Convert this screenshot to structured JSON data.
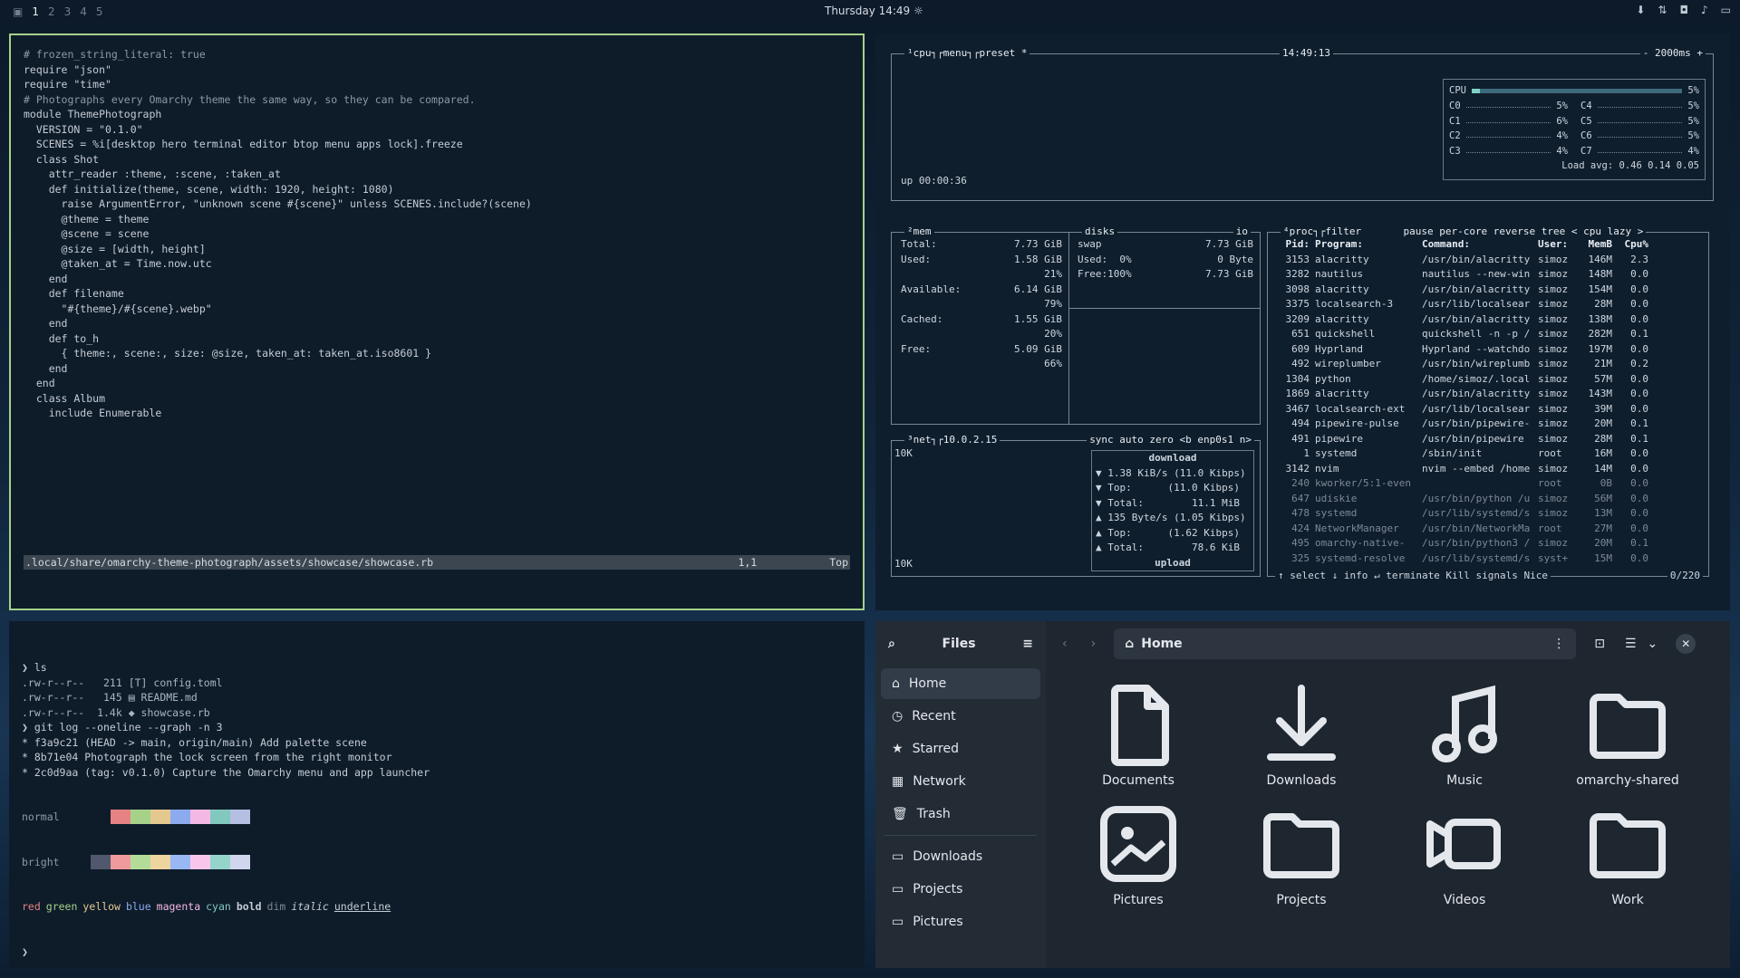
{
  "topbar": {
    "workspaces": [
      "1",
      "2",
      "3",
      "4",
      "5"
    ],
    "clock": "Thursday 14:49"
  },
  "editor": {
    "lines": [
      "# frozen_string_literal: true",
      "",
      "require \"json\"",
      "require \"time\"",
      "",
      "# Photographs every Omarchy theme the same way, so they can be compared.",
      "module ThemePhotograph",
      "  VERSION = \"0.1.0\"",
      "  SCENES = %i[desktop hero terminal editor btop menu apps lock].freeze",
      "",
      "  class Shot",
      "    attr_reader :theme, :scene, :taken_at",
      "",
      "    def initialize(theme, scene, width: 1920, height: 1080)",
      "      raise ArgumentError, \"unknown scene #{scene}\" unless SCENES.include?(scene)",
      "",
      "      @theme = theme",
      "      @scene = scene",
      "      @size = [width, height]",
      "      @taken_at = Time.now.utc",
      "    end",
      "",
      "    def filename",
      "      \"#{theme}/#{scene}.webp\"",
      "    end",
      "",
      "    def to_h",
      "      { theme:, scene:, size: @size, taken_at: taken_at.iso8601 }",
      "    end",
      "  end",
      "",
      "  class Album",
      "    include Enumerable"
    ],
    "status_path": ".local/share/omarchy-theme-photograph/assets/showcase/showcase.rb",
    "status_pos": "1,1",
    "status_scroll": "Top"
  },
  "btop": {
    "cpu_title": "¹cpu",
    "cpu_menu": "menu",
    "cpu_preset": "preset *",
    "cpu_time": "14:49:13",
    "cpu_rate": "- 2000ms +",
    "cpu_total_label": "CPU",
    "cpu_total": "5%",
    "cores": [
      [
        "C0",
        "5%"
      ],
      [
        "C1",
        "6%"
      ],
      [
        "C2",
        "4%"
      ],
      [
        "C3",
        "4%"
      ],
      [
        "C4",
        "5%"
      ],
      [
        "C5",
        "5%"
      ],
      [
        "C6",
        "5%"
      ],
      [
        "C7",
        "4%"
      ]
    ],
    "load_avg": "Load avg: 0.46 0.14 0.05",
    "uptime": "up 00:00:36",
    "mem_title": "²mem",
    "disks_title": "disks",
    "io_title": "io",
    "mem": [
      [
        "Total:",
        "7.73 GiB"
      ],
      [
        "Used:",
        "1.58 GiB"
      ],
      [
        "",
        "21%"
      ],
      [
        "Available:",
        "6.14 GiB"
      ],
      [
        "",
        "79%"
      ],
      [
        "Cached:",
        "1.55 GiB"
      ],
      [
        "",
        "20%"
      ],
      [
        "Free:",
        "5.09 GiB"
      ],
      [
        "",
        "66%"
      ]
    ],
    "swap": [
      [
        "swap",
        "7.73 GiB"
      ],
      [
        "Used:  0%",
        "0 Byte"
      ],
      [
        "Free:100%",
        "7.73 GiB"
      ]
    ],
    "net_title": "³net",
    "net_ip": "10.0.2.15",
    "net_opts": "sync auto zero <b enp0s1 n>",
    "net_scale_top": "10K",
    "net_scale_bottom": "10K",
    "net_rows": [
      "download",
      "▼ 1.38 KiB/s (11.0 Kibps)",
      "▼ Top:      (11.0 Kibps)",
      "▼ Total:        11.1 MiB",
      "▲ 135 Byte/s (1.05 Kibps)",
      "▲ Top:      (1.62 Kibps)",
      "▲ Total:        78.6 KiB",
      "upload"
    ],
    "proc_title": "⁴proc",
    "proc_opts": "filter       pause per-core reverse tree < cpu lazy >",
    "proc_headers": [
      "Pid:",
      "Program:",
      "Command:",
      "User:",
      "MemB",
      "Cpu%"
    ],
    "procs": [
      [
        "3153",
        "alacritty",
        "/usr/bin/alacritty",
        "simoz",
        "146M",
        "2.3"
      ],
      [
        "3282",
        "nautilus",
        "nautilus --new-win",
        "simoz",
        "148M",
        "0.0"
      ],
      [
        "3098",
        "alacritty",
        "/usr/bin/alacritty",
        "simoz",
        "154M",
        "0.0"
      ],
      [
        "3375",
        "localsearch-3",
        "/usr/lib/localsear",
        "simoz",
        "28M",
        "0.0"
      ],
      [
        "3209",
        "alacritty",
        "/usr/bin/alacritty",
        "simoz",
        "138M",
        "0.0"
      ],
      [
        "651",
        "quickshell",
        "quickshell -n -p /",
        "simoz",
        "282M",
        "0.1"
      ],
      [
        "609",
        "Hyprland",
        "Hyprland --watchdo",
        "simoz",
        "197M",
        "0.0"
      ],
      [
        "492",
        "wireplumber",
        "/usr/bin/wireplumb",
        "simoz",
        "21M",
        "0.2"
      ],
      [
        "1304",
        "python",
        "/home/simoz/.local",
        "simoz",
        "57M",
        "0.0"
      ],
      [
        "1869",
        "alacritty",
        "/usr/bin/alacritty",
        "simoz",
        "143M",
        "0.0"
      ],
      [
        "3467",
        "localsearch-ext",
        "/usr/lib/localsear",
        "simoz",
        "39M",
        "0.0"
      ],
      [
        "494",
        "pipewire-pulse",
        "/usr/bin/pipewire-",
        "simoz",
        "20M",
        "0.1"
      ],
      [
        "491",
        "pipewire",
        "/usr/bin/pipewire",
        "simoz",
        "28M",
        "0.1"
      ],
      [
        "1",
        "systemd",
        "/sbin/init",
        "root",
        "16M",
        "0.0"
      ],
      [
        "3142",
        "nvim",
        "nvim --embed /home",
        "simoz",
        "14M",
        "0.0"
      ],
      [
        "240",
        "kworker/5:1-even",
        "",
        "root",
        "0B",
        "0.0"
      ],
      [
        "647",
        "udiskie",
        "/usr/bin/python /u",
        "simoz",
        "56M",
        "0.0"
      ],
      [
        "478",
        "systemd",
        "/usr/lib/systemd/s",
        "simoz",
        "13M",
        "0.0"
      ],
      [
        "424",
        "NetworkManager",
        "/usr/bin/NetworkMa",
        "root",
        "27M",
        "0.0"
      ],
      [
        "495",
        "omarchy-native-",
        "/usr/bin/python3 /",
        "simoz",
        "20M",
        "0.1"
      ],
      [
        "325",
        "systemd-resolve",
        "/usr/lib/systemd/s",
        "syst+",
        "15M",
        "0.0"
      ]
    ],
    "proc_footer": "↑ select ↓ info ↵ terminate Kill signals Nice",
    "proc_count": "0/220"
  },
  "shell": {
    "lines": [
      "❯ ls",
      ".rw-r--r--   211 [T] config.toml",
      ".rw-r--r--   145 ▤ README.md",
      ".rw-r--r--  1.4k ◆ showcase.rb",
      "❯ git log --oneline --graph -n 3",
      "* f3a9c21 (HEAD -> main, origin/main) Add palette scene",
      "* 8b71e04 Photograph the lock screen from the right monitor",
      "* 2c0d9aa (tag: v0.1.0) Capture the Omarchy menu and app launcher"
    ],
    "normal_label": "normal",
    "bright_label": "bright",
    "palette_normal": [
      "#0e1c2a",
      "#e78284",
      "#a6d189",
      "#e5c890",
      "#8caaee",
      "#f4b8e4",
      "#81c8be",
      "#b5bfe2"
    ],
    "palette_bright": [
      "#51576d",
      "#ef9a9c",
      "#b4dc98",
      "#eed49f",
      "#99b7f3",
      "#f8c6ea",
      "#94d4ca",
      "#d0d6ee"
    ],
    "styles": [
      "red",
      "green",
      "yellow",
      "blue",
      "magenta",
      "cyan",
      "bold",
      "dim",
      "italic",
      "underline"
    ],
    "prompt": "❯"
  },
  "files": {
    "title": "Files",
    "location": "Home",
    "sidebar": [
      "Home",
      "Recent",
      "Starred",
      "Network",
      "Trash"
    ],
    "bookmarks": [
      "Downloads",
      "Projects",
      "Pictures"
    ],
    "items": [
      {
        "name": "Documents",
        "icon": "document-icon"
      },
      {
        "name": "Downloads",
        "icon": "download-icon"
      },
      {
        "name": "Music",
        "icon": "music-icon"
      },
      {
        "name": "omarchy-shared",
        "icon": "folder-shared-icon"
      },
      {
        "name": "Pictures",
        "icon": "picture-icon"
      },
      {
        "name": "Projects",
        "icon": "folder-icon"
      },
      {
        "name": "Videos",
        "icon": "video-icon"
      },
      {
        "name": "Work",
        "icon": "folder-icon"
      }
    ]
  }
}
